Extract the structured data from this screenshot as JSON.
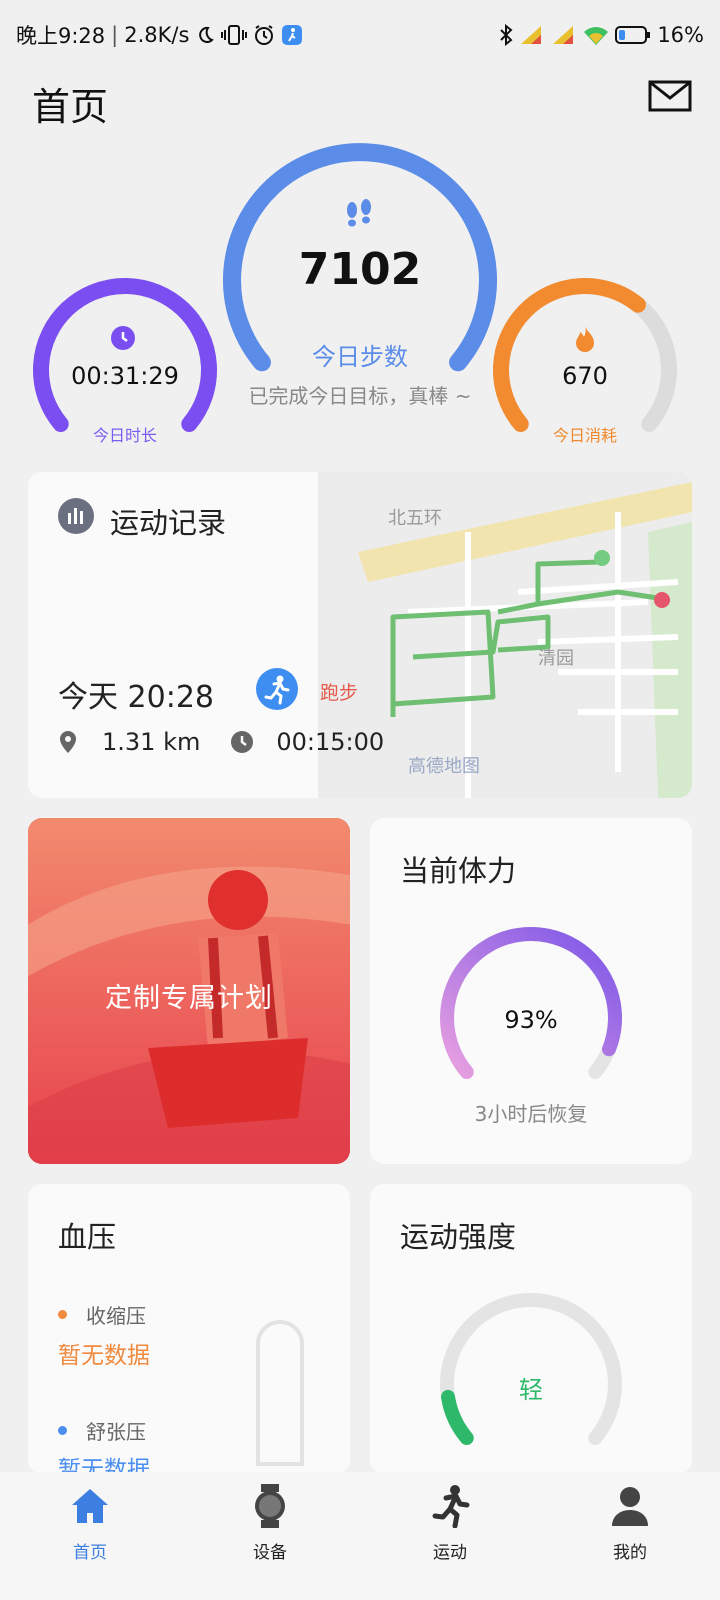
{
  "status_bar": {
    "time": "晚上9:28",
    "net_speed": "2.8K/s",
    "battery": "16%",
    "icons": [
      "moon-icon",
      "vibrate-icon",
      "alarm-icon",
      "app-notification-icon",
      "bluetooth-icon",
      "signal-hd-icon",
      "signal-hd-icon-2",
      "wifi-icon",
      "battery-icon"
    ]
  },
  "header": {
    "title": "首页",
    "mail_icon": "mail-icon"
  },
  "rings": {
    "steps": {
      "value": "7102",
      "label": "今日步数",
      "subtitle": "已完成今日目标，真棒 ~",
      "color": "#5b8de8",
      "progress": 1.0
    },
    "duration": {
      "value": "00:31:29",
      "label": "今日时长",
      "color": "#7a4ef0",
      "progress": 1.0
    },
    "calories": {
      "value": "670",
      "label": "今日消耗",
      "color": "#f28a30",
      "progress": 0.65
    }
  },
  "record": {
    "title": "运动记录",
    "time": "今天 20:28",
    "type": "跑步",
    "distance": "1.31 km",
    "duration": "00:15:00",
    "map_labels": {
      "road": "北五环",
      "area": "清园",
      "provider": "高德地图"
    }
  },
  "plan": {
    "label": "定制专属计划"
  },
  "stamina": {
    "title": "当前体力",
    "value": "93%",
    "subtitle": "3小时后恢复",
    "progress": 0.93
  },
  "blood_pressure": {
    "title": "血压",
    "systolic_label": "收缩压",
    "systolic_value": "暂无数据",
    "diastolic_label": "舒张压",
    "diastolic_value": "暂无数据",
    "colors": {
      "systolic": "#f08a3e",
      "diastolic": "#4a8ef0"
    }
  },
  "intensity": {
    "title": "运动强度",
    "value": "轻",
    "color": "#2db86a",
    "progress": 0.12
  },
  "nav": {
    "items": [
      {
        "label": "首页",
        "icon": "home-icon",
        "active": true
      },
      {
        "label": "设备",
        "icon": "watch-icon",
        "active": false
      },
      {
        "label": "运动",
        "icon": "running-icon",
        "active": false
      },
      {
        "label": "我的",
        "icon": "profile-icon",
        "active": false
      }
    ]
  }
}
